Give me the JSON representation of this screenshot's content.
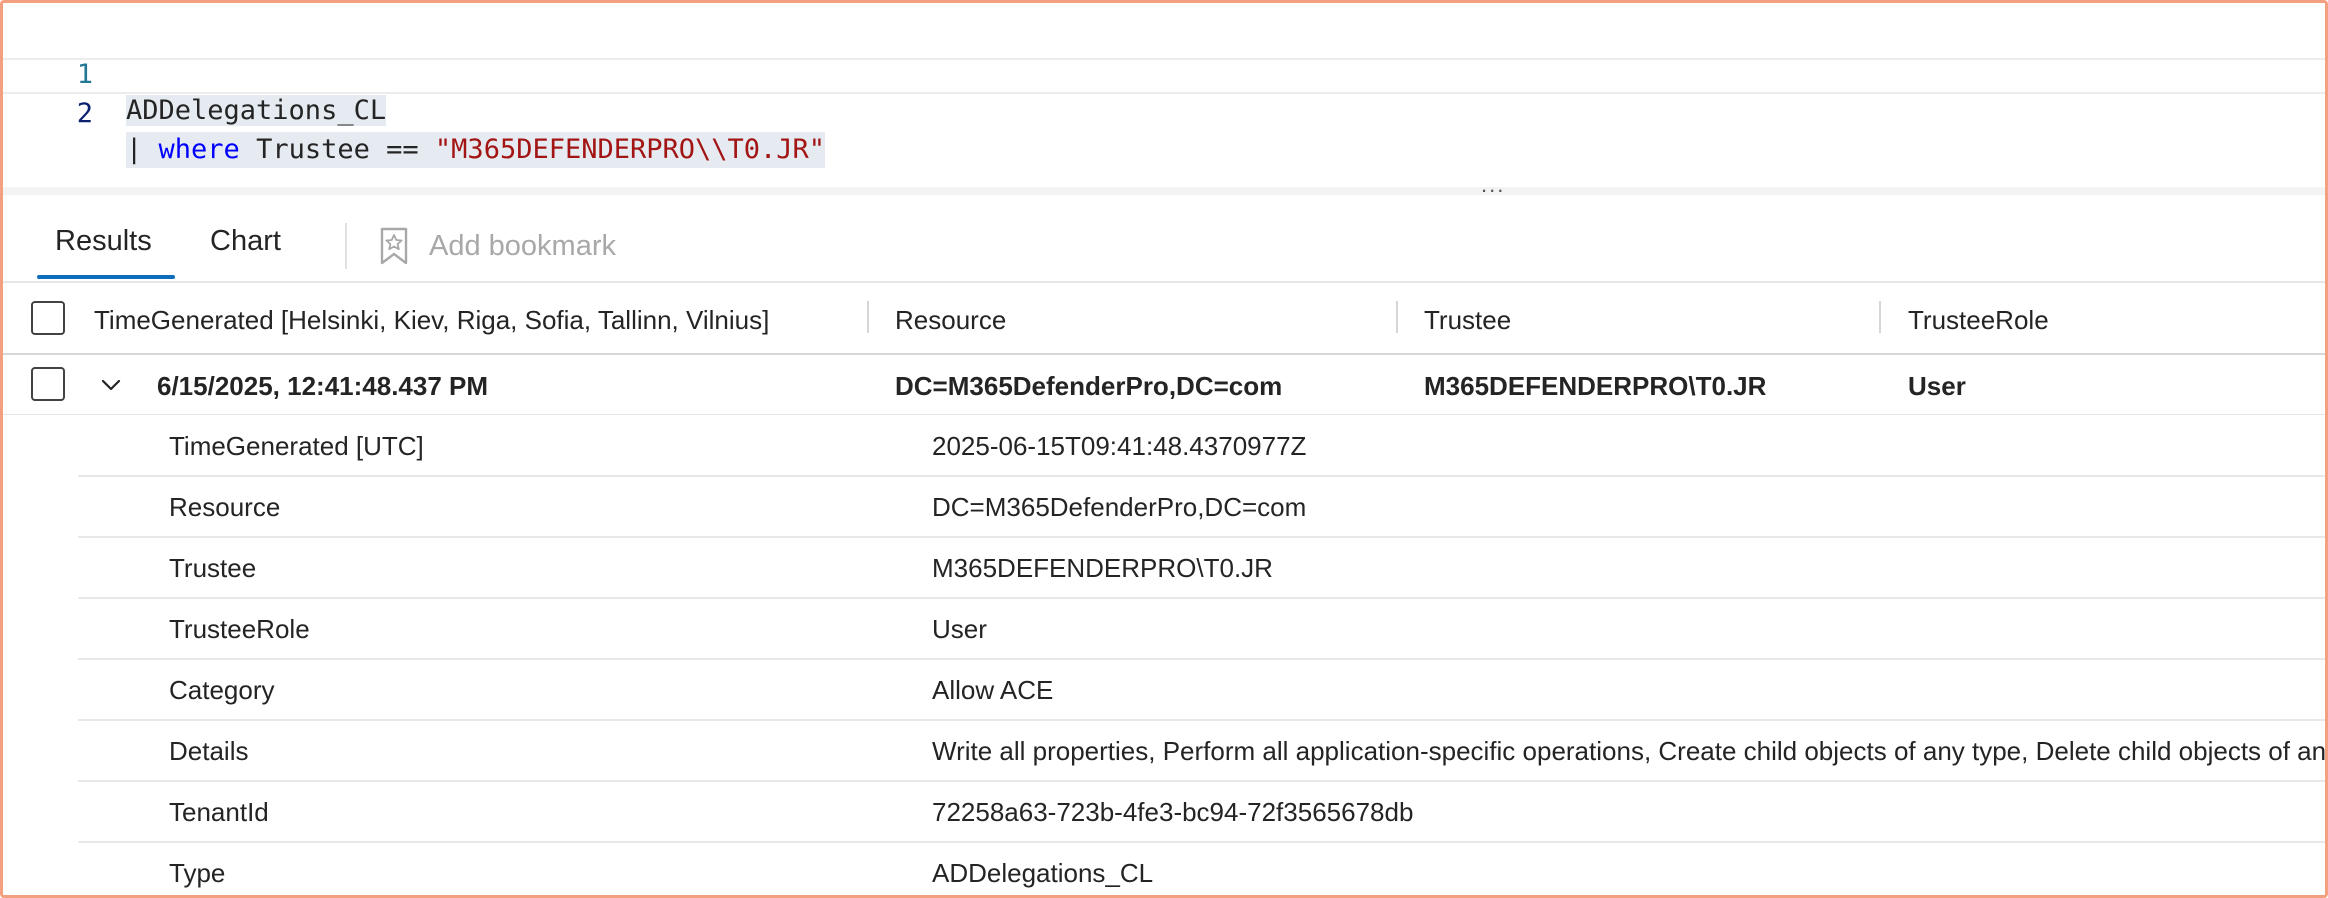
{
  "editor": {
    "lines": [
      {
        "number": "1",
        "text": "ADDelegations_CL"
      },
      {
        "number": "2",
        "pipe": "|",
        "keyword": "where",
        "field": "Trustee",
        "operator": "==",
        "string": "\"M365DEFENDERPRO\\\\T0.JR\""
      }
    ],
    "splitter_label": "..."
  },
  "tabs": {
    "results": "Results",
    "chart": "Chart",
    "bookmark_label": "Add bookmark",
    "bookmark_icon": "bookmark-star-icon"
  },
  "grid": {
    "columns": [
      "TimeGenerated [Helsinki, Kiev, Riga, Sofia, Tallinn, Vilnius]",
      "Resource",
      "Trustee",
      "TrusteeRole"
    ],
    "row": {
      "time": "6/15/2025, 12:41:48.437 PM",
      "resource": "DC=M365DefenderPro,DC=com",
      "trustee": "M365DEFENDERPRO\\T0.JR",
      "role": "User"
    },
    "details": [
      {
        "key": "TimeGenerated [UTC]",
        "value": "2025-06-15T09:41:48.4370977Z"
      },
      {
        "key": "Resource",
        "value": "DC=M365DefenderPro,DC=com"
      },
      {
        "key": "Trustee",
        "value": "M365DEFENDERPRO\\T0.JR"
      },
      {
        "key": "TrusteeRole",
        "value": "User"
      },
      {
        "key": "Category",
        "value": "Allow ACE"
      },
      {
        "key": "Details",
        "value": "Write all properties, Perform all application-specific operations, Create child objects of any type, Delete child objects of any type"
      },
      {
        "key": "TenantId",
        "value": "72258a63-723b-4fe3-bc94-72f3565678db"
      },
      {
        "key": "Type",
        "value": "ADDelegations_CL"
      }
    ]
  },
  "colors": {
    "accent": "#0f6cbd",
    "keyword": "#0000ff",
    "string": "#a31515",
    "line_number": "#237893",
    "frame": "#f2a07f"
  }
}
